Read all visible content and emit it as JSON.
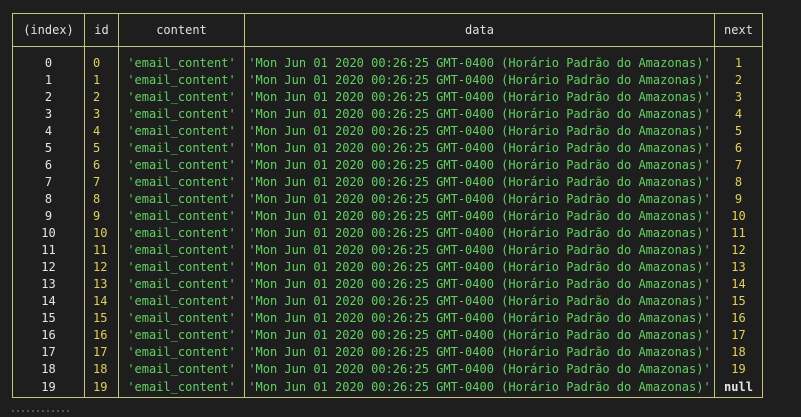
{
  "table": {
    "headers": [
      "(index)",
      "id",
      "content",
      "data",
      "next"
    ],
    "rows": [
      {
        "index": "0",
        "id": "0",
        "content": "'email_content'",
        "data": "'Mon Jun 01 2020 00:26:25 GMT-0400 (Horário Padrão do Amazonas)'",
        "next": "1"
      },
      {
        "index": "1",
        "id": "1",
        "content": "'email_content'",
        "data": "'Mon Jun 01 2020 00:26:25 GMT-0400 (Horário Padrão do Amazonas)'",
        "next": "2"
      },
      {
        "index": "2",
        "id": "2",
        "content": "'email_content'",
        "data": "'Mon Jun 01 2020 00:26:25 GMT-0400 (Horário Padrão do Amazonas)'",
        "next": "3"
      },
      {
        "index": "3",
        "id": "3",
        "content": "'email_content'",
        "data": "'Mon Jun 01 2020 00:26:25 GMT-0400 (Horário Padrão do Amazonas)'",
        "next": "4"
      },
      {
        "index": "4",
        "id": "4",
        "content": "'email_content'",
        "data": "'Mon Jun 01 2020 00:26:25 GMT-0400 (Horário Padrão do Amazonas)'",
        "next": "5"
      },
      {
        "index": "5",
        "id": "5",
        "content": "'email_content'",
        "data": "'Mon Jun 01 2020 00:26:25 GMT-0400 (Horário Padrão do Amazonas)'",
        "next": "6"
      },
      {
        "index": "6",
        "id": "6",
        "content": "'email_content'",
        "data": "'Mon Jun 01 2020 00:26:25 GMT-0400 (Horário Padrão do Amazonas)'",
        "next": "7"
      },
      {
        "index": "7",
        "id": "7",
        "content": "'email_content'",
        "data": "'Mon Jun 01 2020 00:26:25 GMT-0400 (Horário Padrão do Amazonas)'",
        "next": "8"
      },
      {
        "index": "8",
        "id": "8",
        "content": "'email_content'",
        "data": "'Mon Jun 01 2020 00:26:25 GMT-0400 (Horário Padrão do Amazonas)'",
        "next": "9"
      },
      {
        "index": "9",
        "id": "9",
        "content": "'email_content'",
        "data": "'Mon Jun 01 2020 00:26:25 GMT-0400 (Horário Padrão do Amazonas)'",
        "next": "10"
      },
      {
        "index": "10",
        "id": "10",
        "content": "'email_content'",
        "data": "'Mon Jun 01 2020 00:26:25 GMT-0400 (Horário Padrão do Amazonas)'",
        "next": "11"
      },
      {
        "index": "11",
        "id": "11",
        "content": "'email_content'",
        "data": "'Mon Jun 01 2020 00:26:25 GMT-0400 (Horário Padrão do Amazonas)'",
        "next": "12"
      },
      {
        "index": "12",
        "id": "12",
        "content": "'email_content'",
        "data": "'Mon Jun 01 2020 00:26:25 GMT-0400 (Horário Padrão do Amazonas)'",
        "next": "13"
      },
      {
        "index": "13",
        "id": "13",
        "content": "'email_content'",
        "data": "'Mon Jun 01 2020 00:26:25 GMT-0400 (Horário Padrão do Amazonas)'",
        "next": "14"
      },
      {
        "index": "14",
        "id": "14",
        "content": "'email_content'",
        "data": "'Mon Jun 01 2020 00:26:25 GMT-0400 (Horário Padrão do Amazonas)'",
        "next": "15"
      },
      {
        "index": "15",
        "id": "15",
        "content": "'email_content'",
        "data": "'Mon Jun 01 2020 00:26:25 GMT-0400 (Horário Padrão do Amazonas)'",
        "next": "16"
      },
      {
        "index": "16",
        "id": "16",
        "content": "'email_content'",
        "data": "'Mon Jun 01 2020 00:26:25 GMT-0400 (Horário Padrão do Amazonas)'",
        "next": "17"
      },
      {
        "index": "17",
        "id": "17",
        "content": "'email_content'",
        "data": "'Mon Jun 01 2020 00:26:25 GMT-0400 (Horário Padrão do Amazonas)'",
        "next": "18"
      },
      {
        "index": "18",
        "id": "18",
        "content": "'email_content'",
        "data": "'Mon Jun 01 2020 00:26:25 GMT-0400 (Horário Padrão do Amazonas)'",
        "next": "19"
      },
      {
        "index": "19",
        "id": "19",
        "content": "'email_content'",
        "data": "'Mon Jun 01 2020 00:26:25 GMT-0400 (Horário Padrão do Amazonas)'",
        "next": "null"
      }
    ]
  },
  "colors": {
    "background": "#1e1e1e",
    "border": "#c5c57a",
    "number": "#e3d34c",
    "string": "#5fd35f",
    "plain": "#e6e6e6"
  }
}
